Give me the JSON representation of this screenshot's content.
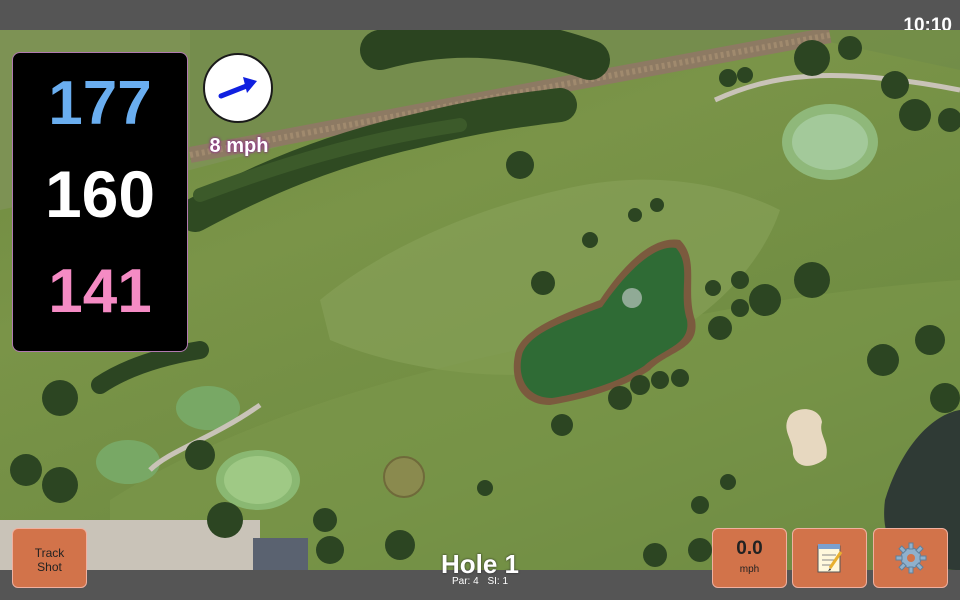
{
  "status": {
    "clock": "10:10"
  },
  "distances": {
    "back": "177",
    "middle": "160",
    "front": "141",
    "colors": {
      "back": "#6aaef0",
      "middle": "#ffffff",
      "front": "#f58bc4"
    }
  },
  "wind": {
    "speed_label": "8 mph",
    "direction": "east-northeast",
    "arrow_color": "#1020e0"
  },
  "buttons": {
    "track_shot_line1": "Track",
    "track_shot_line2": "Shot",
    "speed_value": "0.0",
    "speed_unit": "mph",
    "notes_icon": "notepad-icon",
    "settings_icon": "gear-icon"
  },
  "hole": {
    "title": "Hole 1",
    "par_label": "Par: 4",
    "si_label": "SI: 1"
  },
  "map": {
    "type": "satellite-golf-course"
  },
  "colors": {
    "button_bg": "#d2734a",
    "bar_bg": "#555555"
  }
}
